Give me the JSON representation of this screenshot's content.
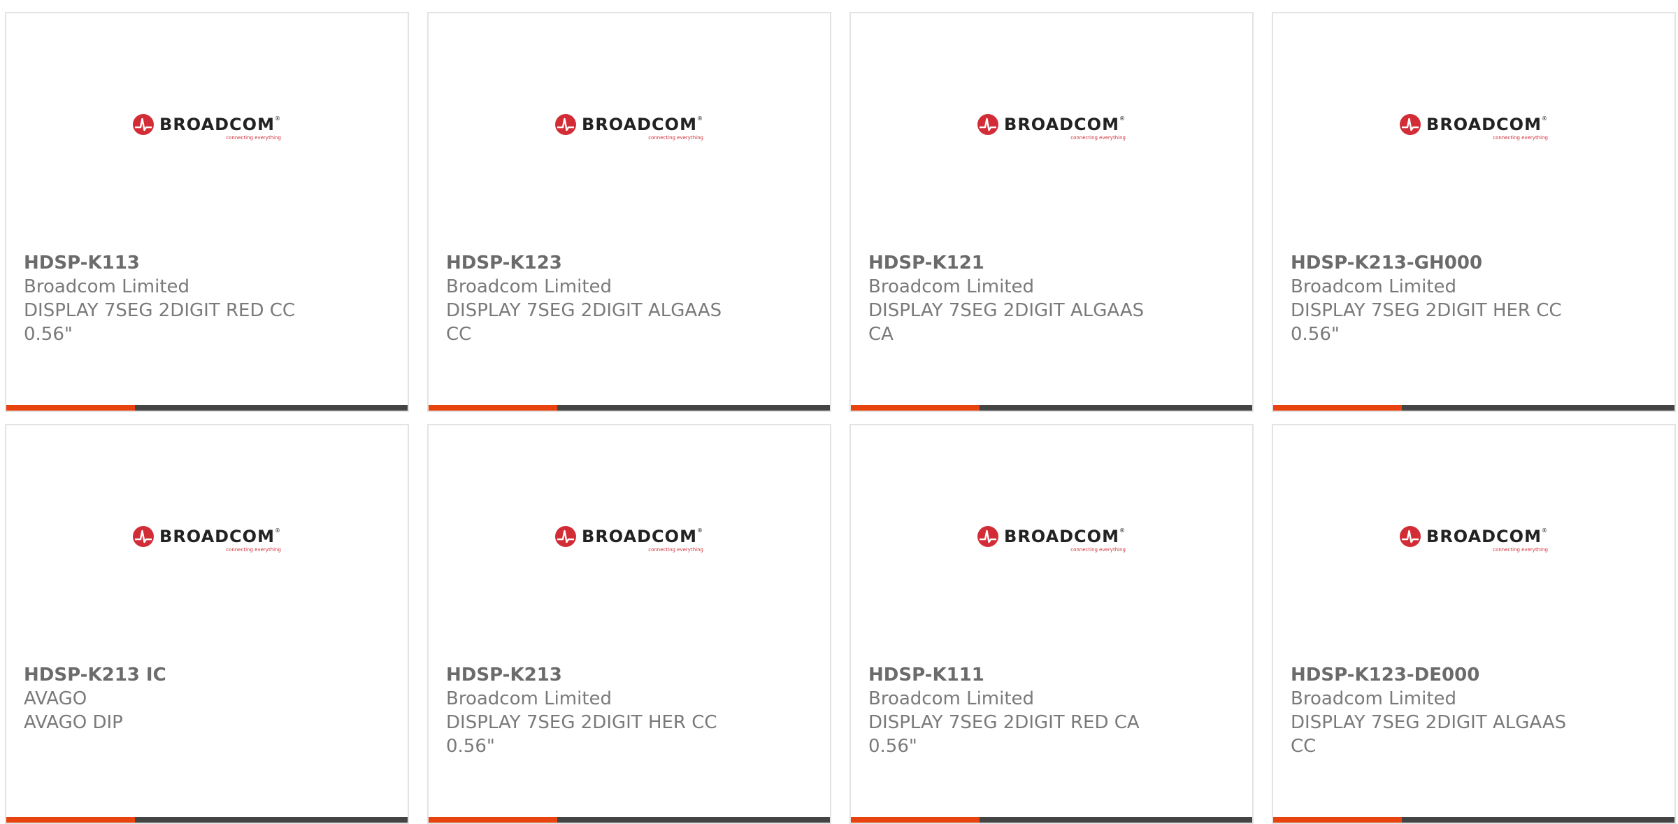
{
  "brand": {
    "logo_word": "BROADCOM",
    "logo_trademark": "®",
    "logo_tagline": "connecting everything",
    "logo_color": "#d22d36"
  },
  "colors": {
    "accent": "#e8420f",
    "bar": "#444444",
    "card_border": "#e3e3e3",
    "text": "#7a7a7a"
  },
  "products": [
    {
      "part_number": "HDSP-K113",
      "manufacturer": "Broadcom Limited",
      "description": "DISPLAY 7SEG 2DIGIT RED CC 0.56\""
    },
    {
      "part_number": "HDSP-K123",
      "manufacturer": "Broadcom Limited",
      "description": "DISPLAY 7SEG 2DIGIT ALGAAS CC"
    },
    {
      "part_number": "HDSP-K121",
      "manufacturer": "Broadcom Limited",
      "description": "DISPLAY 7SEG 2DIGIT ALGAAS CA"
    },
    {
      "part_number": "HDSP-K213-GH000",
      "manufacturer": "Broadcom Limited",
      "description": "DISPLAY 7SEG 2DIGIT HER CC 0.56\""
    },
    {
      "part_number": "HDSP-K213 IC",
      "manufacturer": "AVAGO",
      "description": "AVAGO DIP"
    },
    {
      "part_number": "HDSP-K213",
      "manufacturer": "Broadcom Limited",
      "description": "DISPLAY 7SEG 2DIGIT HER CC 0.56\""
    },
    {
      "part_number": "HDSP-K111",
      "manufacturer": "Broadcom Limited",
      "description": "DISPLAY 7SEG 2DIGIT RED CA 0.56\""
    },
    {
      "part_number": "HDSP-K123-DE000",
      "manufacturer": "Broadcom Limited",
      "description": "DISPLAY 7SEG 2DIGIT ALGAAS CC"
    }
  ]
}
